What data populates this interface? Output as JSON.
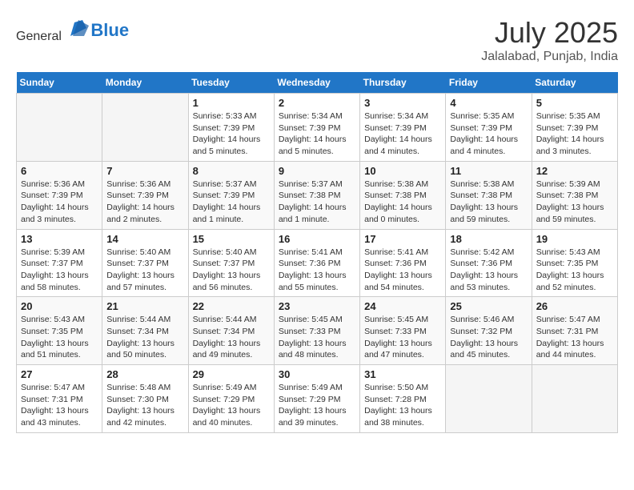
{
  "header": {
    "logo_general": "General",
    "logo_blue": "Blue",
    "month_year": "July 2025",
    "location": "Jalalabad, Punjab, India"
  },
  "weekdays": [
    "Sunday",
    "Monday",
    "Tuesday",
    "Wednesday",
    "Thursday",
    "Friday",
    "Saturday"
  ],
  "weeks": [
    [
      {
        "day": "",
        "info": ""
      },
      {
        "day": "",
        "info": ""
      },
      {
        "day": "1",
        "info": "Sunrise: 5:33 AM\nSunset: 7:39 PM\nDaylight: 14 hours and 5 minutes."
      },
      {
        "day": "2",
        "info": "Sunrise: 5:34 AM\nSunset: 7:39 PM\nDaylight: 14 hours and 5 minutes."
      },
      {
        "day": "3",
        "info": "Sunrise: 5:34 AM\nSunset: 7:39 PM\nDaylight: 14 hours and 4 minutes."
      },
      {
        "day": "4",
        "info": "Sunrise: 5:35 AM\nSunset: 7:39 PM\nDaylight: 14 hours and 4 minutes."
      },
      {
        "day": "5",
        "info": "Sunrise: 5:35 AM\nSunset: 7:39 PM\nDaylight: 14 hours and 3 minutes."
      }
    ],
    [
      {
        "day": "6",
        "info": "Sunrise: 5:36 AM\nSunset: 7:39 PM\nDaylight: 14 hours and 3 minutes."
      },
      {
        "day": "7",
        "info": "Sunrise: 5:36 AM\nSunset: 7:39 PM\nDaylight: 14 hours and 2 minutes."
      },
      {
        "day": "8",
        "info": "Sunrise: 5:37 AM\nSunset: 7:39 PM\nDaylight: 14 hours and 1 minute."
      },
      {
        "day": "9",
        "info": "Sunrise: 5:37 AM\nSunset: 7:38 PM\nDaylight: 14 hours and 1 minute."
      },
      {
        "day": "10",
        "info": "Sunrise: 5:38 AM\nSunset: 7:38 PM\nDaylight: 14 hours and 0 minutes."
      },
      {
        "day": "11",
        "info": "Sunrise: 5:38 AM\nSunset: 7:38 PM\nDaylight: 13 hours and 59 minutes."
      },
      {
        "day": "12",
        "info": "Sunrise: 5:39 AM\nSunset: 7:38 PM\nDaylight: 13 hours and 59 minutes."
      }
    ],
    [
      {
        "day": "13",
        "info": "Sunrise: 5:39 AM\nSunset: 7:37 PM\nDaylight: 13 hours and 58 minutes."
      },
      {
        "day": "14",
        "info": "Sunrise: 5:40 AM\nSunset: 7:37 PM\nDaylight: 13 hours and 57 minutes."
      },
      {
        "day": "15",
        "info": "Sunrise: 5:40 AM\nSunset: 7:37 PM\nDaylight: 13 hours and 56 minutes."
      },
      {
        "day": "16",
        "info": "Sunrise: 5:41 AM\nSunset: 7:36 PM\nDaylight: 13 hours and 55 minutes."
      },
      {
        "day": "17",
        "info": "Sunrise: 5:41 AM\nSunset: 7:36 PM\nDaylight: 13 hours and 54 minutes."
      },
      {
        "day": "18",
        "info": "Sunrise: 5:42 AM\nSunset: 7:36 PM\nDaylight: 13 hours and 53 minutes."
      },
      {
        "day": "19",
        "info": "Sunrise: 5:43 AM\nSunset: 7:35 PM\nDaylight: 13 hours and 52 minutes."
      }
    ],
    [
      {
        "day": "20",
        "info": "Sunrise: 5:43 AM\nSunset: 7:35 PM\nDaylight: 13 hours and 51 minutes."
      },
      {
        "day": "21",
        "info": "Sunrise: 5:44 AM\nSunset: 7:34 PM\nDaylight: 13 hours and 50 minutes."
      },
      {
        "day": "22",
        "info": "Sunrise: 5:44 AM\nSunset: 7:34 PM\nDaylight: 13 hours and 49 minutes."
      },
      {
        "day": "23",
        "info": "Sunrise: 5:45 AM\nSunset: 7:33 PM\nDaylight: 13 hours and 48 minutes."
      },
      {
        "day": "24",
        "info": "Sunrise: 5:45 AM\nSunset: 7:33 PM\nDaylight: 13 hours and 47 minutes."
      },
      {
        "day": "25",
        "info": "Sunrise: 5:46 AM\nSunset: 7:32 PM\nDaylight: 13 hours and 45 minutes."
      },
      {
        "day": "26",
        "info": "Sunrise: 5:47 AM\nSunset: 7:31 PM\nDaylight: 13 hours and 44 minutes."
      }
    ],
    [
      {
        "day": "27",
        "info": "Sunrise: 5:47 AM\nSunset: 7:31 PM\nDaylight: 13 hours and 43 minutes."
      },
      {
        "day": "28",
        "info": "Sunrise: 5:48 AM\nSunset: 7:30 PM\nDaylight: 13 hours and 42 minutes."
      },
      {
        "day": "29",
        "info": "Sunrise: 5:49 AM\nSunset: 7:29 PM\nDaylight: 13 hours and 40 minutes."
      },
      {
        "day": "30",
        "info": "Sunrise: 5:49 AM\nSunset: 7:29 PM\nDaylight: 13 hours and 39 minutes."
      },
      {
        "day": "31",
        "info": "Sunrise: 5:50 AM\nSunset: 7:28 PM\nDaylight: 13 hours and 38 minutes."
      },
      {
        "day": "",
        "info": ""
      },
      {
        "day": "",
        "info": ""
      }
    ]
  ]
}
